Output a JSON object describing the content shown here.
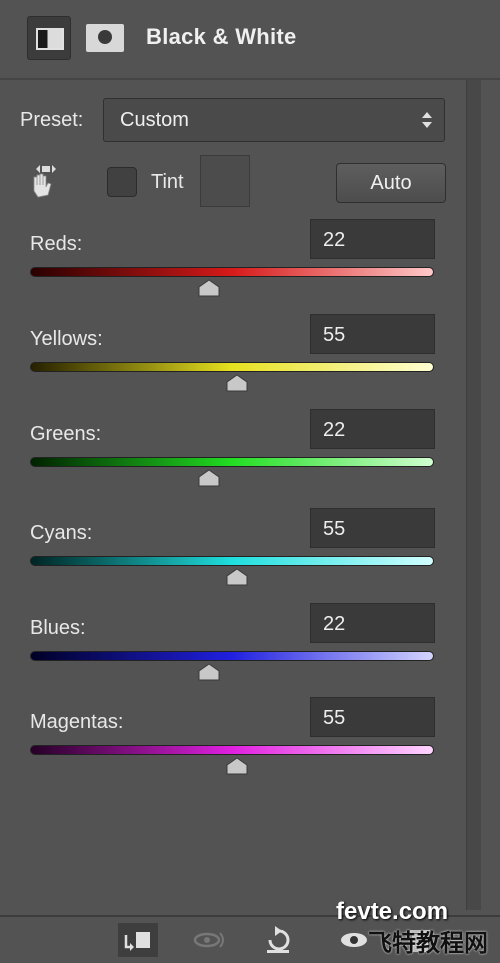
{
  "header": {
    "title": "Black & White"
  },
  "preset": {
    "label": "Preset:",
    "value": "Custom"
  },
  "tint": {
    "label": "Tint",
    "checked": false
  },
  "auto_button": {
    "label": "Auto"
  },
  "sliders": [
    {
      "label": "Reds:",
      "value": "22",
      "gradient": [
        "#2a0000",
        "#d61a1a",
        "#ffc8c8"
      ]
    },
    {
      "label": "Yellows:",
      "value": "55",
      "gradient": [
        "#262000",
        "#e6e020",
        "#ffffd2"
      ]
    },
    {
      "label": "Greens:",
      "value": "22",
      "gradient": [
        "#002200",
        "#22dd22",
        "#d0ffd0"
      ]
    },
    {
      "label": "Cyans:",
      "value": "55",
      "gradient": [
        "#002424",
        "#20dede",
        "#d2ffff"
      ]
    },
    {
      "label": "Blues:",
      "value": "22",
      "gradient": [
        "#000026",
        "#2020e0",
        "#d4d4ff"
      ]
    },
    {
      "label": "Magentas:",
      "value": "55",
      "gradient": [
        "#260026",
        "#e020e0",
        "#ffd4ff"
      ]
    }
  ],
  "watermark": {
    "line1": "fevte.com",
    "line2": "飞特教程网"
  }
}
